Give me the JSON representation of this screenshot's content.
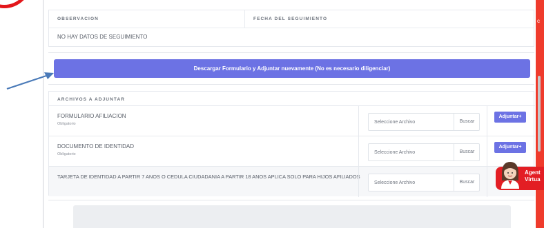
{
  "tracking": {
    "col_observation": "OBSERVACION",
    "col_date": "FECHA DEL SEGUIMIENTO",
    "empty_message": "NO HAY DATOS DE SEGUIMIENTO"
  },
  "download_button": "Descargar Formulario y Adjuntar nuevamente (No es necesario diligenciar)",
  "attachments": {
    "title": "ARCHIVOS A ADJUNTAR",
    "rows": [
      {
        "name": "FORMULARIO AFILIACION",
        "required": "Obligatorio",
        "placeholder": "Seleccione Archivo",
        "browse": "Buscar",
        "attach": "Adjuntar+"
      },
      {
        "name": "DOCUMENTO DE IDENTIDAD",
        "required": "Obligatorio",
        "placeholder": "Seleccione Archivo",
        "browse": "Buscar",
        "attach": "Adjuntar+"
      },
      {
        "name": "TARJETA DE IDENTIDAD A PARTIR 7 ANOS O CEDULA CIUDADANIA A PARTIR 18 ANOS APLICA SOLO PARA HIJOS AFILIADOS",
        "placeholder": "Seleccione Archivo",
        "browse": "Buscar"
      }
    ]
  },
  "agent": {
    "label": "Agent\nVirtua"
  },
  "icons": {
    "arrow": "annotation-arrow-icon",
    "agent": "virtual-agent-avatar-icon"
  },
  "colors": {
    "primary": "#6c72e4",
    "brand_red": "#e31e24",
    "arrow": "#4a7ab8"
  }
}
